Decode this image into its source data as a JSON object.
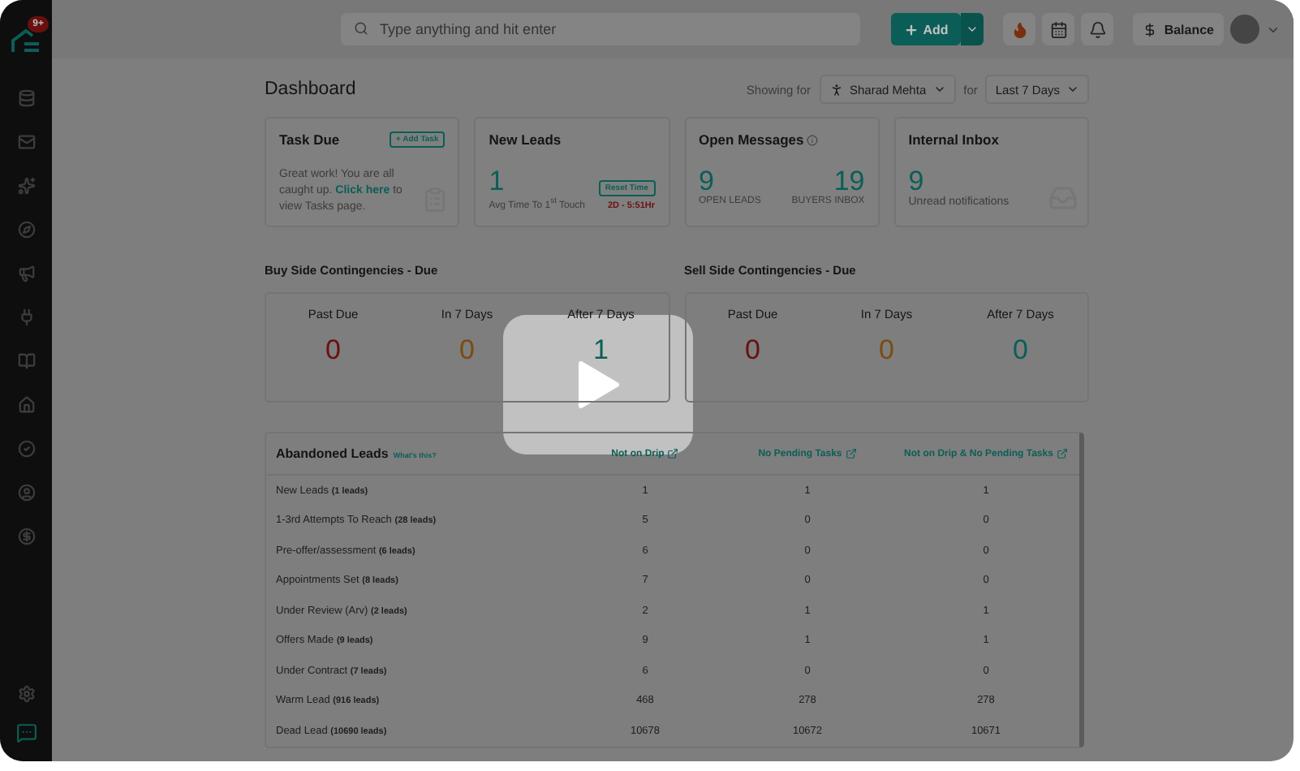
{
  "sidebar": {
    "badge": "9+"
  },
  "search": {
    "placeholder": "Type anything and hit enter"
  },
  "header": {
    "add_button": "Add",
    "balance": "Balance"
  },
  "page": {
    "title": "Dashboard",
    "showing_for": "Showing for",
    "user": "Sharad Mehta",
    "for_label": "for",
    "period": "Last 7 Days"
  },
  "task_due": {
    "title": "Task Due",
    "button": "+ Add Task",
    "message_before": "Great work! You are all caught up.",
    "link": "Click here",
    "message_after": "to view Tasks page."
  },
  "new_leads": {
    "title": "New Leads",
    "value": "1",
    "caption": "Avg Time To 1$^{st}$ Touch",
    "button": "Reset Time",
    "time": "2D - 5:51Hr"
  },
  "open_messages": {
    "title": "Open Messages",
    "stats": [
      {
        "value": "9",
        "label": "OPEN LEADS"
      },
      {
        "value": "19",
        "label": "BUYERS INBOX"
      }
    ]
  },
  "internal_inbox": {
    "title": "Internal Inbox",
    "value": "9",
    "caption": "Unread notifications"
  },
  "contingencies": [
    {
      "title": "Buy Side Contingencies - Due",
      "items": [
        {
          "label": "Past Due",
          "value": "0",
          "color": "#6a1010"
        },
        {
          "label": "In 7 Days",
          "value": "0",
          "color": "#7a4c12"
        },
        {
          "label": "After 7 Days",
          "value": "1",
          "color": "#0d5e58"
        }
      ]
    },
    {
      "title": "Sell Side Contingencies - Due",
      "items": [
        {
          "label": "Past Due",
          "value": "0",
          "color": "#6a1010"
        },
        {
          "label": "In 7 Days",
          "value": "0",
          "color": "#7a4c12"
        },
        {
          "label": "After 7 Days",
          "value": "0",
          "color": "#0d5e58"
        }
      ]
    }
  ],
  "abandoned": {
    "title": "Abandoned Leads",
    "help": "What's this?",
    "columns": [
      "Not on Drip",
      "No Pending Tasks",
      "Not on Drip & No Pending Tasks"
    ],
    "rows": [
      {
        "label": "New Leads **(1 leads)**",
        "values": [
          "1",
          "1",
          "1"
        ]
      },
      {
        "label": "1-3rd Attempts To Reach **(28 leads)**",
        "values": [
          "5",
          "0",
          "0"
        ]
      },
      {
        "label": "Pre-offer/assessment **(6 leads)**",
        "values": [
          "6",
          "0",
          "0"
        ]
      },
      {
        "label": "Appointments Set **(8 leads)**",
        "values": [
          "7",
          "0",
          "0"
        ]
      },
      {
        "label": "Under Review (Arv) **(2 leads)**",
        "values": [
          "2",
          "1",
          "1"
        ]
      },
      {
        "label": "Offers Made **(9 leads)**",
        "values": [
          "9",
          "1",
          "1"
        ]
      },
      {
        "label": "Under Contract **(7 leads)**",
        "values": [
          "6",
          "0",
          "0"
        ]
      },
      {
        "label": "Warm Lead **(916 leads)**",
        "values": [
          "468",
          "278",
          "278"
        ]
      },
      {
        "label": "Dead Lead **(10690 leads)**",
        "values": [
          "10678",
          "10672",
          "10671"
        ]
      }
    ]
  }
}
